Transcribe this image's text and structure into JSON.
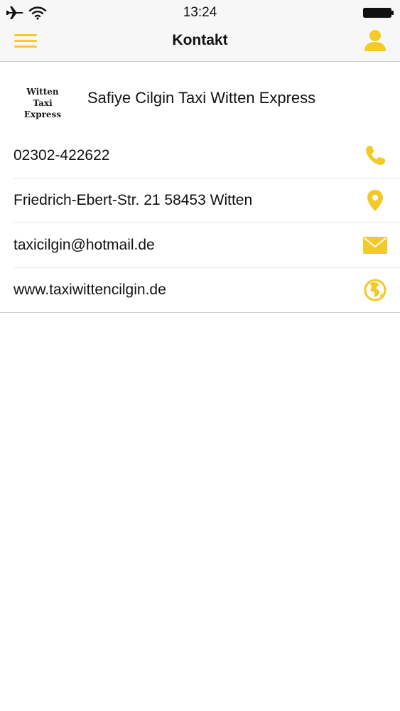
{
  "status_bar": {
    "time": "13:24",
    "icons": [
      "airplane-icon",
      "wifi-icon",
      "battery-icon"
    ]
  },
  "nav": {
    "title": "Kontakt",
    "left_icon": "menu-icon",
    "right_icon": "user-icon"
  },
  "company": {
    "logo_line1": "Witten Taxi",
    "logo_line2": "Express",
    "name": "Safiye Cilgin Taxi Witten Express"
  },
  "contacts": [
    {
      "text": "02302-422622",
      "icon": "phone-icon"
    },
    {
      "text": "Friedrich-Ebert-Str. 21 58453 Witten",
      "icon": "location-pin-icon"
    },
    {
      "text": "taxicilgin@hotmail.de",
      "icon": "mail-icon"
    },
    {
      "text": "www.taxiwittencilgin.de",
      "icon": "globe-icon"
    }
  ],
  "colors": {
    "accent": "#f5c928",
    "bar_background": "#f7f7f7",
    "text": "#111111"
  }
}
